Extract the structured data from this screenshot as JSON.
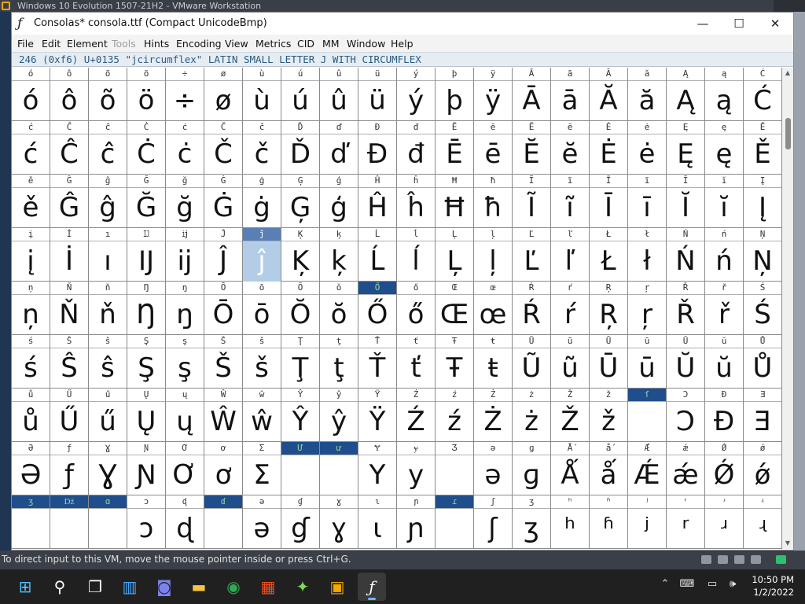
{
  "vmware": {
    "title": "Windows 10 Evolution 1507-21H2 - VMware Workstation"
  },
  "window": {
    "title": "Consolas* consola.ttf (Compact UnicodeBmp)",
    "minimize": "—",
    "maximize": "☐",
    "close": "✕"
  },
  "menu": [
    {
      "label": "File",
      "enabled": true
    },
    {
      "label": "Edit",
      "enabled": true
    },
    {
      "label": "Element",
      "enabled": true
    },
    {
      "label": "Tools",
      "enabled": false
    },
    {
      "label": "Hints",
      "enabled": true
    },
    {
      "label": "Encoding",
      "enabled": true
    },
    {
      "label": "View",
      "enabled": true
    },
    {
      "label": "Metrics",
      "enabled": true
    },
    {
      "label": "CID",
      "enabled": true
    },
    {
      "label": "MM",
      "enabled": true
    },
    {
      "label": "Window",
      "enabled": true
    },
    {
      "label": "Help",
      "enabled": true
    }
  ],
  "info": "246 (0xf6) U+0135 \"jcircumflex\" LATIN SMALL LETTER J WITH CIRCUMFLEX",
  "grid": {
    "columns": 20,
    "rows": [
      {
        "labels": [
          "ó",
          "ô",
          "õ",
          "ö",
          "÷",
          "ø",
          "ù",
          "ú",
          "û",
          "ü",
          "ý",
          "þ",
          "ÿ",
          "Ā",
          "ā",
          "Ă",
          "ă",
          "Ą",
          "ą",
          "Ć"
        ],
        "glyphs": [
          "ó",
          "ô",
          "õ",
          "ö",
          "÷",
          "ø",
          "ù",
          "ú",
          "û",
          "ü",
          "ý",
          "þ",
          "ÿ",
          "Ā",
          "ā",
          "Ă",
          "ă",
          "Ą",
          "ą",
          "Ć"
        ]
      },
      {
        "labels": [
          "ć",
          "Ĉ",
          "ĉ",
          "Ċ",
          "ċ",
          "Č",
          "č",
          "Ď",
          "ď",
          "Đ",
          "đ",
          "Ē",
          "ē",
          "Ĕ",
          "ĕ",
          "Ė",
          "ė",
          "Ę",
          "ę",
          "Ě"
        ],
        "glyphs": [
          "ć",
          "Ĉ",
          "ĉ",
          "Ċ",
          "ċ",
          "Č",
          "č",
          "Ď",
          "ď",
          "Đ",
          "đ",
          "Ē",
          "ē",
          "Ĕ",
          "ĕ",
          "Ė",
          "ė",
          "Ę",
          "ę",
          "Ě"
        ]
      },
      {
        "labels": [
          "ě",
          "Ĝ",
          "ĝ",
          "Ğ",
          "ğ",
          "Ġ",
          "ġ",
          "Ģ",
          "ģ",
          "Ĥ",
          "ĥ",
          "Ħ",
          "ħ",
          "Ĩ",
          "ĩ",
          "Ī",
          "ī",
          "Ĭ",
          "ĭ",
          "Į"
        ],
        "glyphs": [
          "ě",
          "Ĝ",
          "ĝ",
          "Ğ",
          "ğ",
          "Ġ",
          "ġ",
          "Ģ",
          "ģ",
          "Ĥ",
          "ĥ",
          "Ħ",
          "ħ",
          "Ĩ",
          "ĩ",
          "Ī",
          "ī",
          "Ĭ",
          "ĭ",
          "Į"
        ]
      },
      {
        "labels": [
          "į",
          "İ",
          "ı",
          "Ĳ",
          "ĳ",
          "Ĵ",
          "ĵ",
          "Ķ",
          "ķ",
          "Ĺ",
          "ĺ",
          "Ļ",
          "ļ",
          "Ľ",
          "ľ",
          "Ł",
          "ł",
          "Ń",
          "ń",
          "Ņ"
        ],
        "glyphs": [
          "į",
          "İ",
          "ı",
          "Ĳ",
          "ĳ",
          "Ĵ",
          "ĵ",
          "Ķ",
          "ķ",
          "Ĺ",
          "ĺ",
          "Ļ",
          "ļ",
          "Ľ",
          "ľ",
          "Ł",
          "ł",
          "Ń",
          "ń",
          "Ņ"
        ]
      },
      {
        "labels": [
          "ņ",
          "Ň",
          "ň",
          "Ŋ",
          "ŋ",
          "Ō",
          "ō",
          "Ŏ",
          "ŏ",
          "Ő",
          "ő",
          "Œ",
          "œ",
          "Ŕ",
          "ŕ",
          "Ŗ",
          "ŗ",
          "Ř",
          "ř",
          "Ś"
        ],
        "glyphs": [
          "ņ",
          "Ň",
          "ň",
          "Ŋ",
          "ŋ",
          "Ō",
          "ō",
          "Ŏ",
          "ŏ",
          "Ő",
          "ő",
          "Œ",
          "œ",
          "Ŕ",
          "ŕ",
          "Ŗ",
          "ŗ",
          "Ř",
          "ř",
          "Ś"
        ]
      },
      {
        "labels": [
          "ś",
          "Ŝ",
          "ŝ",
          "Ş",
          "ş",
          "Š",
          "š",
          "Ţ",
          "ţ",
          "Ť",
          "ť",
          "Ŧ",
          "ŧ",
          "Ũ",
          "ũ",
          "Ū",
          "ū",
          "Ŭ",
          "ŭ",
          "Ů"
        ],
        "glyphs": [
          "ś",
          "Ŝ",
          "ŝ",
          "Ş",
          "ş",
          "Š",
          "š",
          "Ţ",
          "ţ",
          "Ť",
          "ť",
          "Ŧ",
          "ŧ",
          "Ũ",
          "ũ",
          "Ū",
          "ū",
          "Ŭ",
          "ŭ",
          "Ů"
        ]
      },
      {
        "labels": [
          "ů",
          "Ű",
          "ű",
          "Ų",
          "ų",
          "Ŵ",
          "ŵ",
          "Ŷ",
          "ŷ",
          "Ÿ",
          "Ź",
          "ź",
          "Ż",
          "ż",
          "Ž",
          "ž",
          "ſ",
          "Ɔ",
          "Đ",
          "Ǝ"
        ],
        "glyphs": [
          "ů",
          "Ű",
          "ű",
          "Ų",
          "ų",
          "Ŵ",
          "ŵ",
          "Ŷ",
          "ŷ",
          "Ÿ",
          "Ź",
          "ź",
          "Ż",
          "ż",
          "Ž",
          "ž",
          "",
          "Ɔ",
          "Đ",
          "Ǝ"
        ]
      },
      {
        "labels": [
          "Ə",
          "ƒ",
          "Ɣ",
          "Ɲ",
          "Ơ",
          "ơ",
          "Ʃ",
          "Ư",
          "ư",
          "Ɏ",
          "ɏ",
          "Ʒ",
          "ə",
          "ɡ",
          "Ǻ",
          "ǻ",
          "Ǽ",
          "ǽ",
          "Ǿ",
          "ǿ"
        ],
        "glyphs": [
          "Ə",
          "ƒ",
          "Ɣ",
          "Ɲ",
          "Ơ",
          "ơ",
          "Σ",
          "",
          "",
          "Y",
          "y",
          "",
          "ə",
          "ɡ",
          "Ǻ",
          "ǻ",
          "Ǽ",
          "ǽ",
          "Ǿ",
          "ǿ"
        ]
      },
      {
        "labels": [
          "ʒ",
          "ǅ",
          "ɑ",
          "ɔ",
          "ɖ",
          "ɗ",
          "ə",
          "ɠ",
          "ɣ",
          "ɩ",
          "ɲ",
          "ɾ",
          "ʃ",
          "ʒ",
          "ʰ",
          "ʱ",
          "ʲ",
          "ʳ",
          "ʴ",
          "ʵ"
        ],
        "glyphs": [
          "",
          "",
          "",
          "ɔ",
          "ɖ",
          "",
          "ə",
          "ɠ",
          "ɣ",
          "ɩ",
          "ɲ",
          "",
          "ʃ",
          "ʒ",
          "ʰ",
          "ʱ",
          "ʲ",
          "ʳ",
          "ʴ",
          "ʵ"
        ]
      }
    ],
    "selected": {
      "row": 3,
      "col": 6
    },
    "marked": [
      [
        4,
        9
      ],
      [
        6,
        16
      ],
      [
        7,
        7
      ],
      [
        7,
        8
      ],
      [
        8,
        0
      ],
      [
        8,
        1
      ],
      [
        8,
        2
      ],
      [
        8,
        5
      ],
      [
        8,
        11
      ]
    ]
  },
  "status": {
    "message": "To direct input to this VM, move the mouse pointer inside or press Ctrl+G."
  },
  "taskbar": {
    "apps": [
      {
        "name": "start",
        "glyph": "⊞"
      },
      {
        "name": "search",
        "glyph": "⚲"
      },
      {
        "name": "task-view",
        "glyph": "❐"
      },
      {
        "name": "widgets",
        "glyph": "▥"
      },
      {
        "name": "chat",
        "glyph": "◙"
      },
      {
        "name": "file-explorer",
        "glyph": "▬"
      },
      {
        "name": "chrome",
        "glyph": "◉"
      },
      {
        "name": "store",
        "glyph": "▦"
      },
      {
        "name": "app-green",
        "glyph": "✦"
      },
      {
        "name": "vmware",
        "glyph": "▣"
      },
      {
        "name": "fontforge",
        "glyph": "ƒ"
      }
    ],
    "tray": [
      "⌃",
      "⌨",
      "▭",
      "🕪"
    ],
    "time": "10:50 PM",
    "date": "1/2/2022"
  }
}
